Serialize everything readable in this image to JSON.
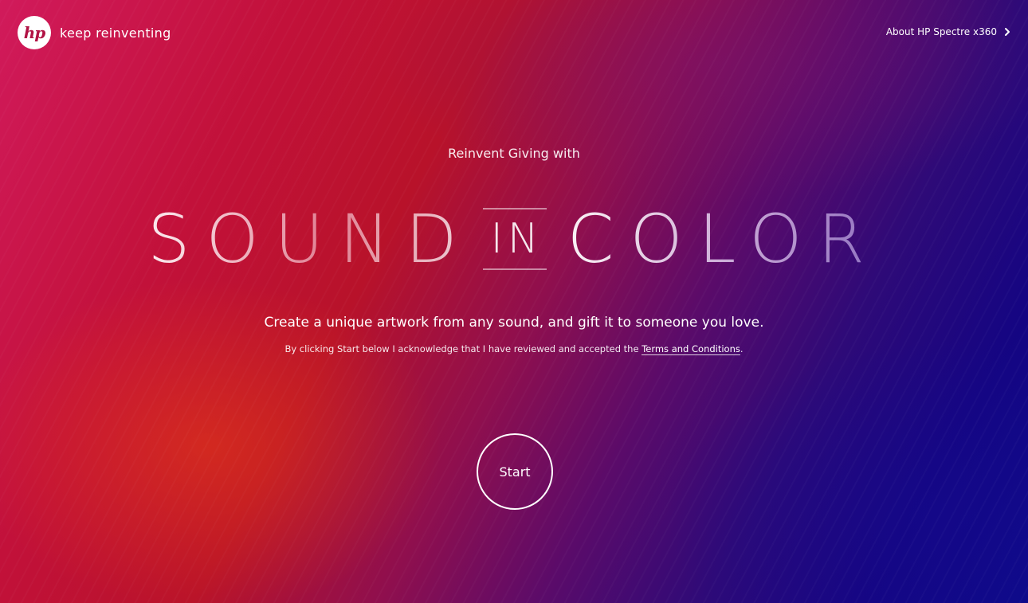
{
  "brand": {
    "logo_text": "hp",
    "tagline": "keep reinventing"
  },
  "nav": {
    "about_label": "About HP Spectre x360"
  },
  "hero": {
    "subtitle": "Reinvent Giving with",
    "title_word_1": "SOUND",
    "title_word_2": "IN",
    "title_word_3": "COLOR",
    "description": "Create a unique artwork from any sound, and gift it to someone you love.",
    "legal_prefix": "By clicking Start below I acknowledge that I have reviewed and accepted the ",
    "terms_label": "Terms and Conditions",
    "legal_suffix": "."
  },
  "actions": {
    "start_label": "Start"
  },
  "colors": {
    "primary_red": "#c2113a",
    "mid_purple": "#5a0b6a",
    "deep_blue": "#0c0a8a",
    "text": "#ffffff"
  },
  "icons": {
    "logo": "hp-logo",
    "about_arrow": "chevron-right-icon"
  }
}
